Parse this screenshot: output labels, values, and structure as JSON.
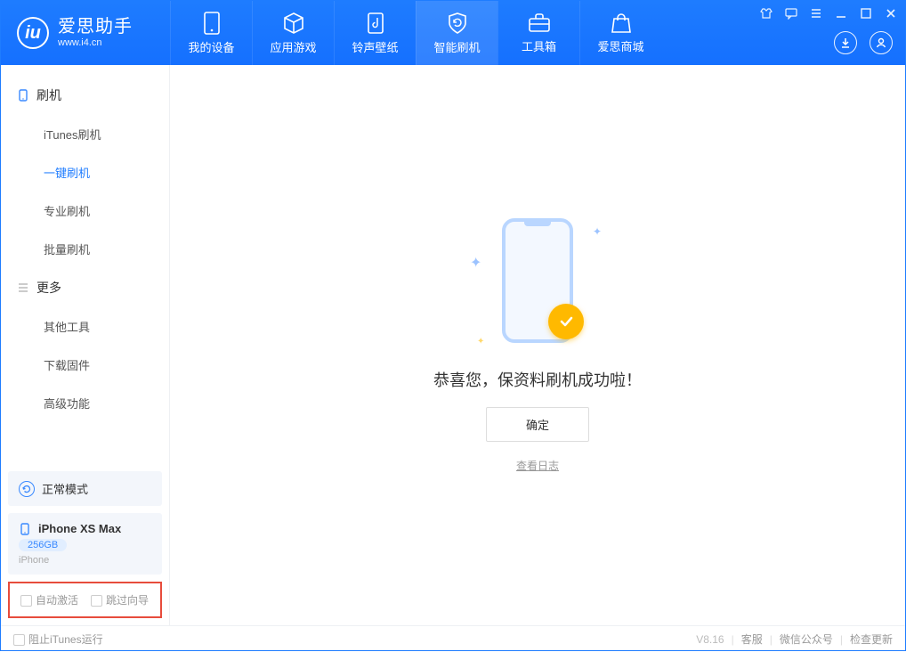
{
  "brand": {
    "name": "爱思助手",
    "url": "www.i4.cn"
  },
  "nav": [
    {
      "label": "我的设备",
      "icon": "device"
    },
    {
      "label": "应用游戏",
      "icon": "cube"
    },
    {
      "label": "铃声壁纸",
      "icon": "note"
    },
    {
      "label": "智能刷机",
      "icon": "shield",
      "active": true
    },
    {
      "label": "工具箱",
      "icon": "toolbox"
    },
    {
      "label": "爱思商城",
      "icon": "bag"
    }
  ],
  "sidebar": {
    "group_flash": {
      "title": "刷机",
      "items": [
        "iTunes刷机",
        "一键刷机",
        "专业刷机",
        "批量刷机"
      ],
      "activeIndex": 1
    },
    "group_more": {
      "title": "更多",
      "items": [
        "其他工具",
        "下载固件",
        "高级功能"
      ]
    },
    "mode_card": {
      "label": "正常模式"
    },
    "device_card": {
      "name": "iPhone XS Max",
      "capacity": "256GB",
      "sub": "iPhone"
    },
    "options": {
      "auto_activate": "自动激活",
      "skip_guide": "跳过向导"
    }
  },
  "main": {
    "success_text": "恭喜您，保资料刷机成功啦！",
    "ok_button": "确定",
    "log_link": "查看日志"
  },
  "statusbar": {
    "block_itunes": "阻止iTunes运行",
    "version": "V8.16",
    "links": [
      "客服",
      "微信公众号",
      "检查更新"
    ]
  }
}
